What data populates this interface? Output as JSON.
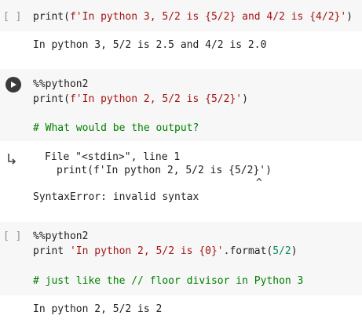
{
  "cells": [
    {
      "prompt": "[ ]",
      "code_parts": [
        "print(",
        "f'In python 3, 5/2 is {5/2} and 4/2 is {4/2}'",
        ")"
      ],
      "output": "In python 3, 5/2 is 2.5 and 4/2 is 2.0"
    },
    {
      "run_icon": "play-icon",
      "magic": "%%python2",
      "code_parts": [
        "print(",
        "f'In python 2, 5/2 is {5/2}'",
        ")"
      ],
      "comment": "# What would be the output?",
      "output_icon": "output-arrow-icon",
      "traceback_line1": "File \"<stdin>\", line 1",
      "traceback_line2": "print(f'In python 2, 5/2 is {5/2}')",
      "caret": "^",
      "error": "SyntaxError: invalid syntax"
    },
    {
      "prompt": "[ ]",
      "magic": "%%python2",
      "code_kw": "print ",
      "code_str": "'In python 2, 5/2 is {0}'",
      "code_method": ".format(",
      "code_num": "5/2",
      "code_close": ")",
      "comment": "# just like the // floor divisor in Python 3",
      "output": "In python 2, 5/2 is 2"
    }
  ]
}
